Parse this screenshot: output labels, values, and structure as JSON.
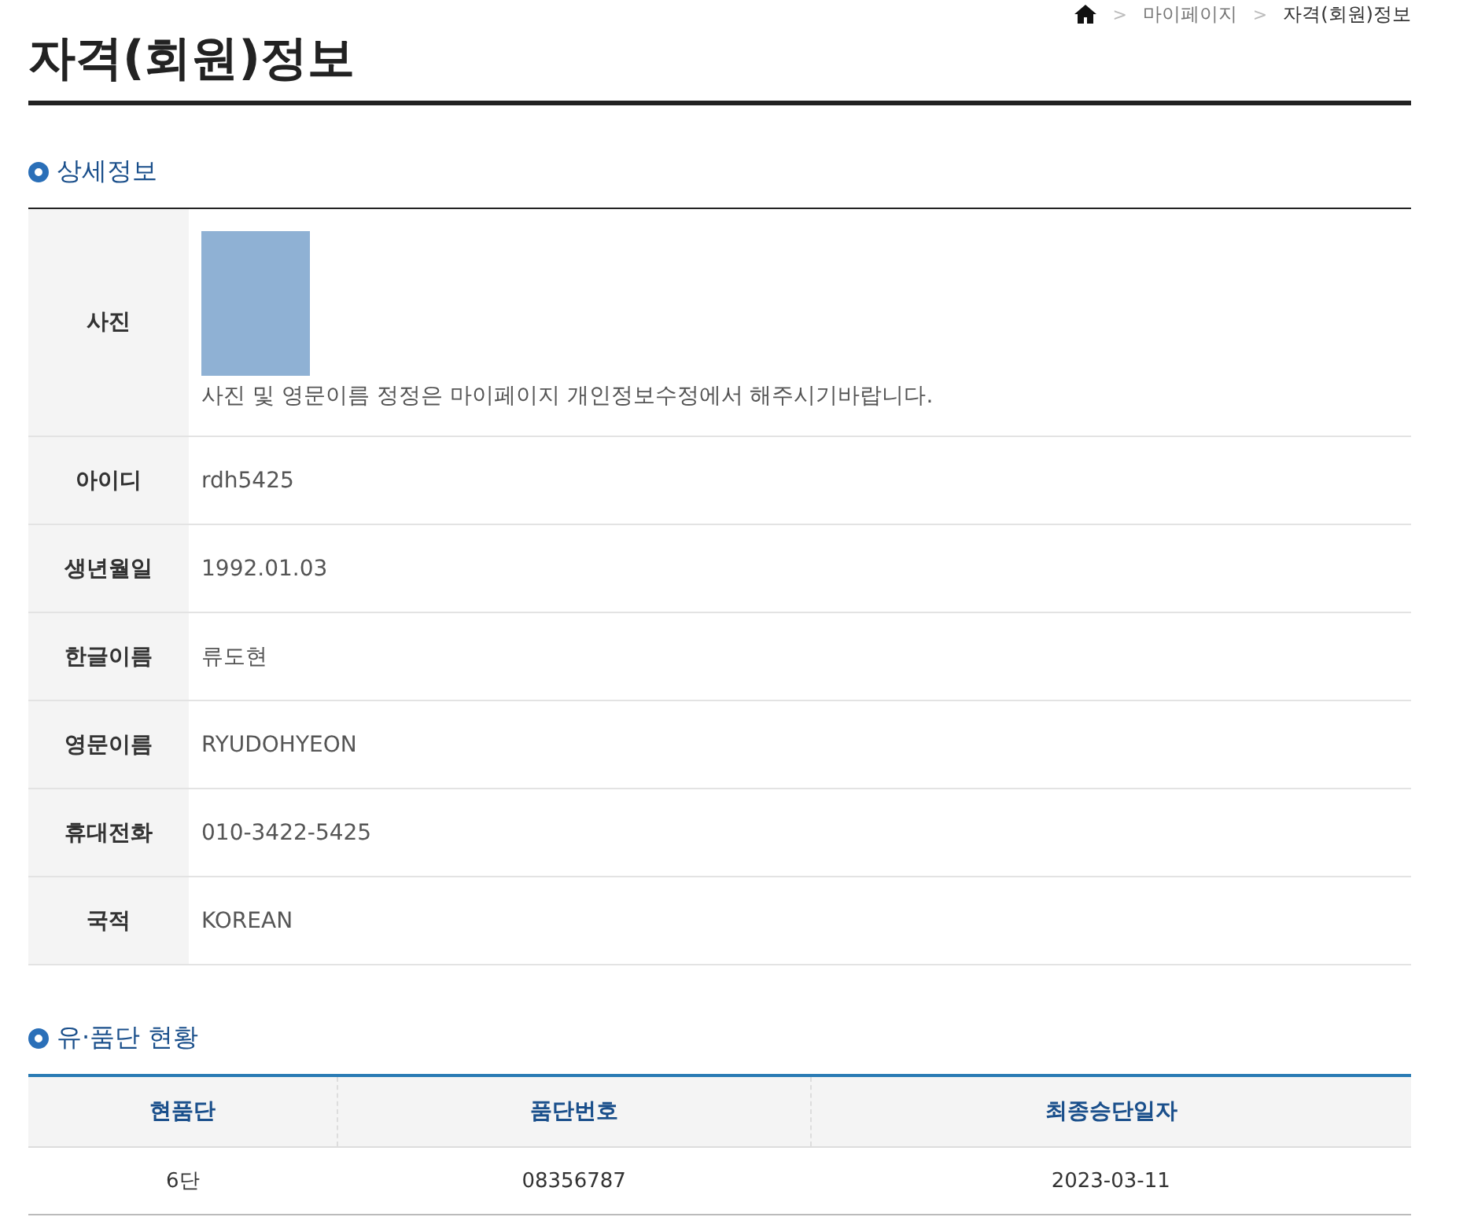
{
  "breadcrumb": {
    "separator": ">",
    "items": [
      "마이페이지",
      "자격(회원)정보"
    ]
  },
  "title": "자격(회원)정보",
  "detail": {
    "heading": "상세정보",
    "photo_label": "사진",
    "photo_note": "사진 및 영문이름 정정은 마이페이지 개인정보수정에서 해주시기바랍니다.",
    "rows": [
      {
        "label": "아이디",
        "value": "rdh5425"
      },
      {
        "label": "생년월일",
        "value": "1992.01.03"
      },
      {
        "label": "한글이름",
        "value": "류도현"
      },
      {
        "label": "영문이름",
        "value": "RYUDOHYEON"
      },
      {
        "label": "휴대전화",
        "value": "010-3422-5425"
      },
      {
        "label": "국적",
        "value": "KOREAN"
      }
    ]
  },
  "rank": {
    "heading": "유·품단 현황",
    "columns": [
      "현품단",
      "품단번호",
      "최종승단일자"
    ],
    "rows": [
      [
        "6단",
        "08356787",
        "2023-03-11"
      ]
    ]
  }
}
